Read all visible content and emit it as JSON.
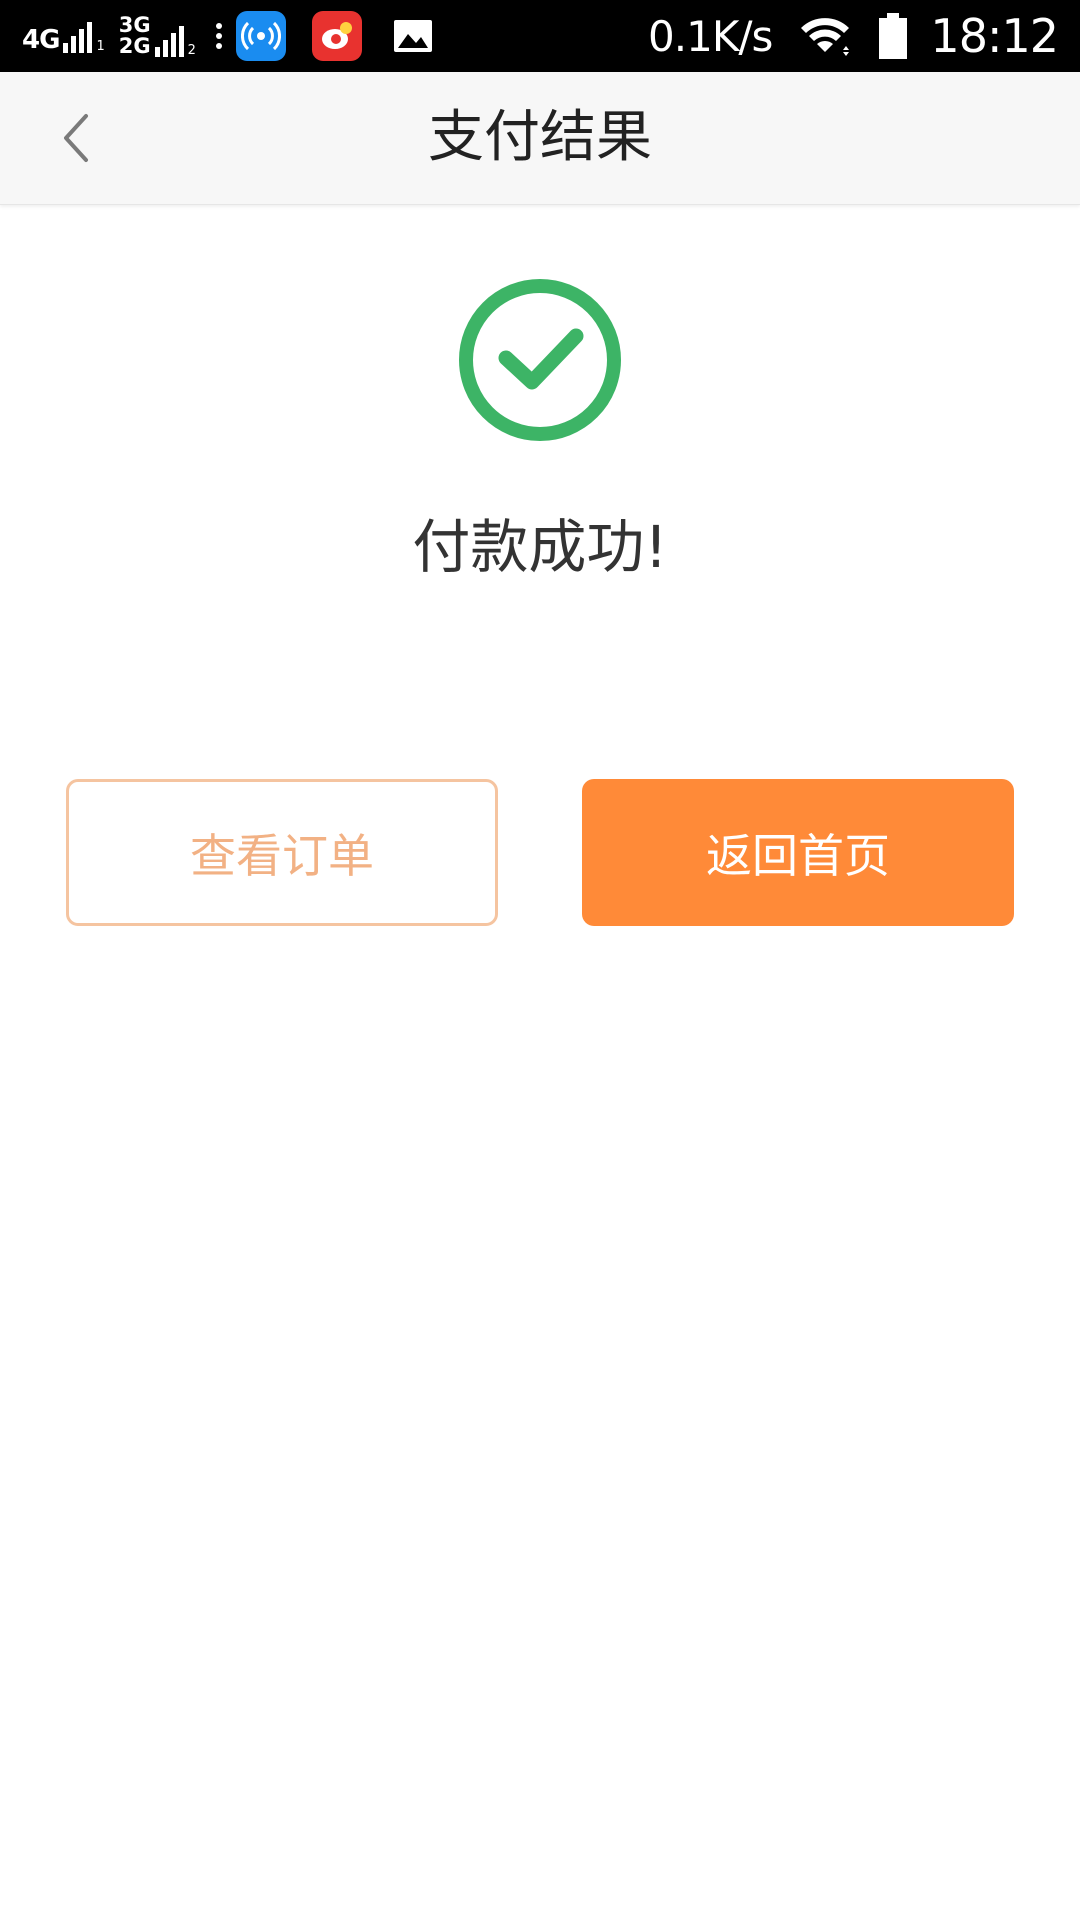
{
  "status_bar": {
    "network_1": "4G",
    "sim_1": "1",
    "network_2_top": "3G",
    "network_2_bottom": "2G",
    "sim_2": "2",
    "speed": "0.1K/s",
    "time": "18:12",
    "icons": [
      "wifi-key-app-icon",
      "weibo-app-icon",
      "gallery-icon",
      "wifi-icon",
      "battery-icon"
    ]
  },
  "header": {
    "title": "支付结果"
  },
  "result": {
    "message": "付款成功!"
  },
  "actions": {
    "view_order": "查看订单",
    "back_home": "返回首页"
  },
  "colors": {
    "success_green": "#3db466",
    "accent_orange": "#ff8a38",
    "outline_orange": "#f5c4a0"
  }
}
